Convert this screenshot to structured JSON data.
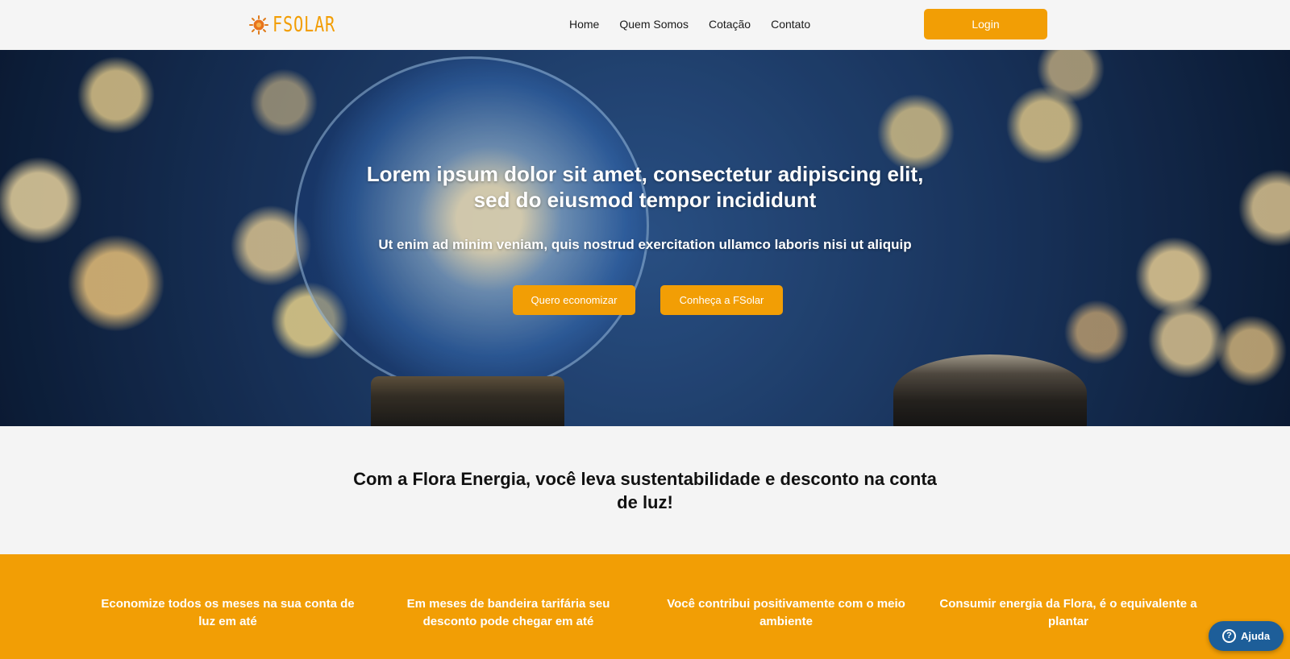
{
  "header": {
    "logo_text": "FSOLAR",
    "logo_icon": "sun-icon",
    "nav": [
      {
        "label": "Home"
      },
      {
        "label": "Quem Somos"
      },
      {
        "label": "Cotação"
      },
      {
        "label": "Contato"
      }
    ],
    "login_label": "Login"
  },
  "hero": {
    "title": "Lorem ipsum dolor sit amet, consectetur adipiscing elit, sed do eiusmod tempor incididunt",
    "subtitle": "Ut enim ad minim veniam, quis nostrud exercitation ullamco laboris nisi ut aliquip",
    "primary_cta": "Quero economizar",
    "secondary_cta": "Conheça a FSolar"
  },
  "tagline": "Com a Flora Energia, você leva sustentabilidade e desconto na conta de luz!",
  "features": [
    {
      "text": "Economize todos os meses na sua conta de luz em até"
    },
    {
      "text": "Em meses de bandeira tarifária seu desconto pode chegar em até"
    },
    {
      "text": "Você contribui positivamente com o meio ambiente"
    },
    {
      "text": "Consumir energia da Flora, é o equivalente a plantar"
    }
  ],
  "help": {
    "label": "Ajuda",
    "icon": "question-icon"
  },
  "colors": {
    "accent": "#f29e05",
    "help_button": "#1d5e99"
  }
}
